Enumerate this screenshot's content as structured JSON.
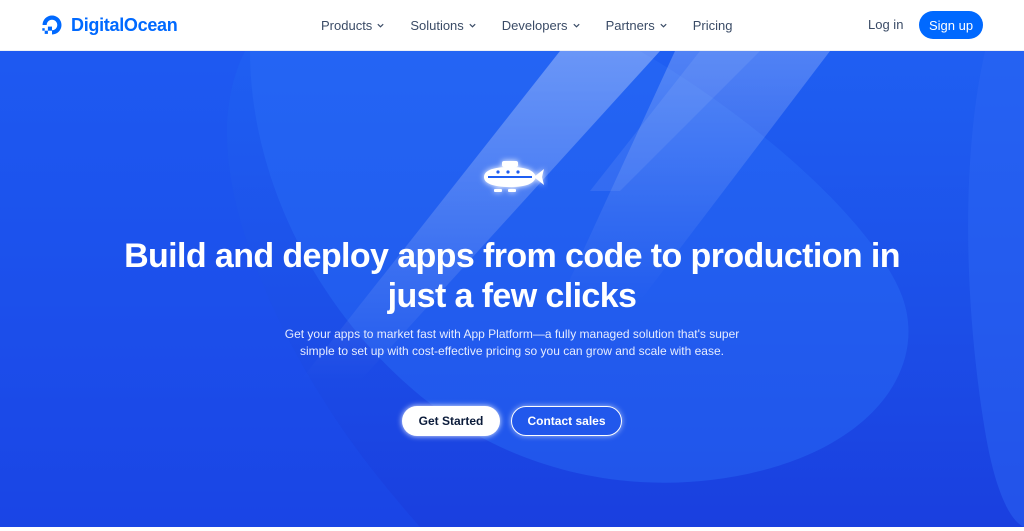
{
  "header": {
    "brand_name": "DigitalOcean",
    "brand_color": "#0069ff",
    "nav": [
      {
        "label": "Products",
        "has_dropdown": true,
        "icon": "chevron-down-icon"
      },
      {
        "label": "Solutions",
        "has_dropdown": true,
        "icon": "chevron-down-icon"
      },
      {
        "label": "Developers",
        "has_dropdown": true,
        "icon": "chevron-down-icon"
      },
      {
        "label": "Partners",
        "has_dropdown": true,
        "icon": "chevron-down-icon"
      },
      {
        "label": "Pricing",
        "has_dropdown": false
      }
    ],
    "login_label": "Log in",
    "signup_label": "Sign up"
  },
  "hero": {
    "illustration_icon": "submarine-icon",
    "headline": "Build and deploy apps from code to production in just a few clicks",
    "subtext": "Get your apps to market fast with App Platform—a fully managed solution that's super simple to set up with cost-effective pricing so you can grow and scale with ease.",
    "primary_cta": "Get Started",
    "secondary_cta": "Contact sales",
    "background_color": "#1c4fe8"
  }
}
